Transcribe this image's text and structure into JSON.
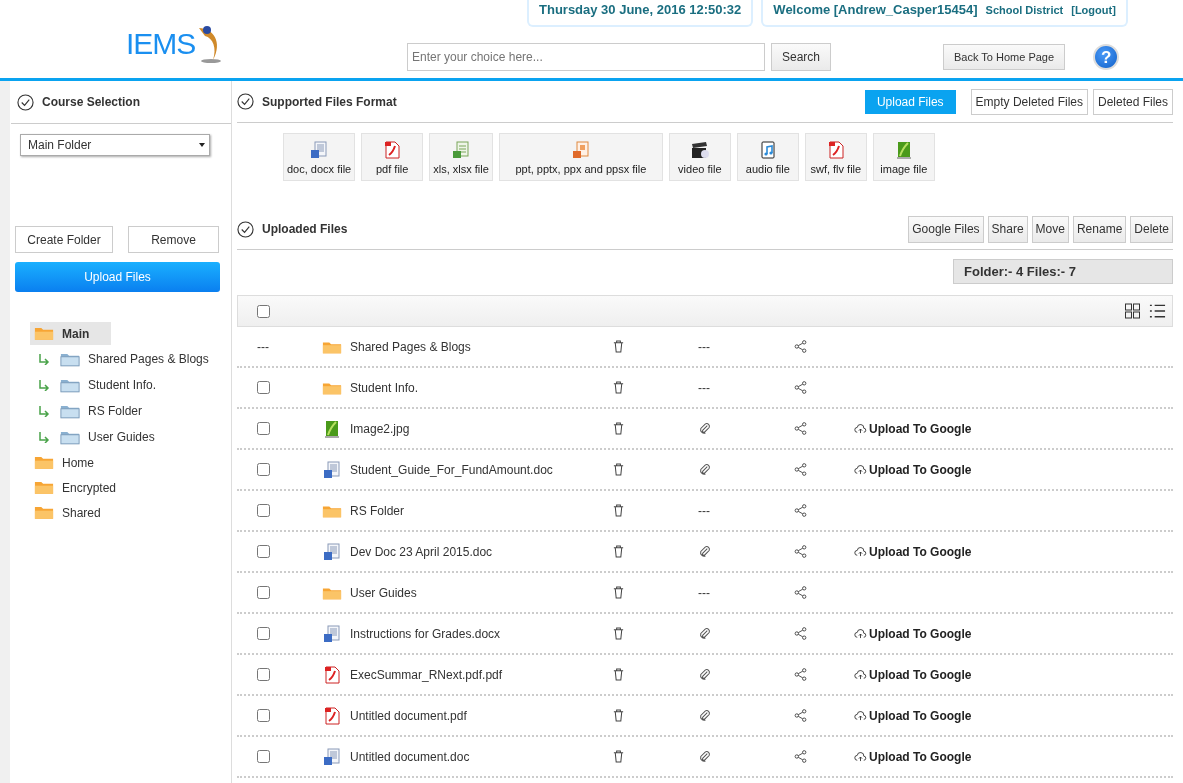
{
  "header": {
    "date": "Thursday 30 June, 2016 12:50:32",
    "welcome": "Welcome [Andrew_Casper15454]",
    "district": "School District",
    "logout": "[Logout]",
    "logo": "IEMS",
    "search": {
      "placeholder": "Enter your choice here..."
    },
    "search_button": "Search",
    "back_button": "Back To Home Page",
    "help": "?"
  },
  "sidebar": {
    "title": "Course Selection",
    "select": "Main Folder",
    "create_button": "Create Folder",
    "remove_button": "Remove",
    "upload_button": "Upload Files",
    "tree": [
      {
        "label": "Main",
        "selected": true,
        "children": [
          {
            "label": "Shared Pages & Blogs",
            "selected": false
          },
          {
            "label": "Student Info.",
            "selected": false
          },
          {
            "label": "RS Folder",
            "selected": false
          },
          {
            "label": "User Guides",
            "selected": false
          }
        ]
      },
      {
        "label": "Home",
        "selected": false
      },
      {
        "label": "Encrypted",
        "selected": false
      },
      {
        "label": "Shared",
        "selected": false
      }
    ]
  },
  "supported": {
    "title": "Supported Files Format",
    "buttons": [
      "Upload Files",
      "Empty Deleted Files",
      "Deleted Files"
    ],
    "formats": [
      {
        "kind": "doc",
        "label": "doc, docx file"
      },
      {
        "kind": "pdf",
        "label": "pdf file"
      },
      {
        "kind": "xls",
        "label": "xls, xlsx file"
      },
      {
        "kind": "ppt",
        "label": "ppt, pptx, ppx and ppsx file"
      },
      {
        "kind": "video",
        "label": "video file"
      },
      {
        "kind": "audio",
        "label": "audio file"
      },
      {
        "kind": "swf",
        "label": "swf, flv file"
      },
      {
        "kind": "image",
        "label": "image file"
      }
    ]
  },
  "uploaded": {
    "title": "Uploaded Files",
    "buttons": [
      "Google Files",
      "Share",
      "Move",
      "Rename",
      "Delete"
    ],
    "summary": "Folder:- 4 Files:- 7",
    "select_all": false,
    "rows": [
      {
        "kind": "folder",
        "select_text": "---",
        "name": "Shared Pages & Blogs",
        "attachment": "---"
      },
      {
        "kind": "folder",
        "checked": false,
        "name": "Student Info.",
        "attachment": "---"
      },
      {
        "kind": "image",
        "checked": false,
        "name": "Image2.jpg",
        "upload": "Upload To Google"
      },
      {
        "kind": "doc",
        "checked": false,
        "name": "Student_Guide_For_FundAmount.doc",
        "upload": "Upload To Google"
      },
      {
        "kind": "folder",
        "checked": false,
        "name": "RS Folder",
        "attachment": "---"
      },
      {
        "kind": "doc",
        "checked": false,
        "name": "Dev Doc 23 April 2015.doc",
        "upload": "Upload To Google"
      },
      {
        "kind": "folder",
        "checked": false,
        "name": "User Guides",
        "attachment": "---"
      },
      {
        "kind": "doc",
        "checked": false,
        "name": "Instructions for Grades.docx",
        "upload": "Upload To Google"
      },
      {
        "kind": "pdf",
        "checked": false,
        "name": "ExecSummar_RNext.pdf.pdf",
        "upload": "Upload To Google"
      },
      {
        "kind": "pdf",
        "checked": false,
        "name": "Untitled document.pdf",
        "upload": "Upload To Google"
      },
      {
        "kind": "doc",
        "checked": false,
        "name": "Untitled document.doc",
        "upload": "Upload To Google"
      }
    ]
  }
}
